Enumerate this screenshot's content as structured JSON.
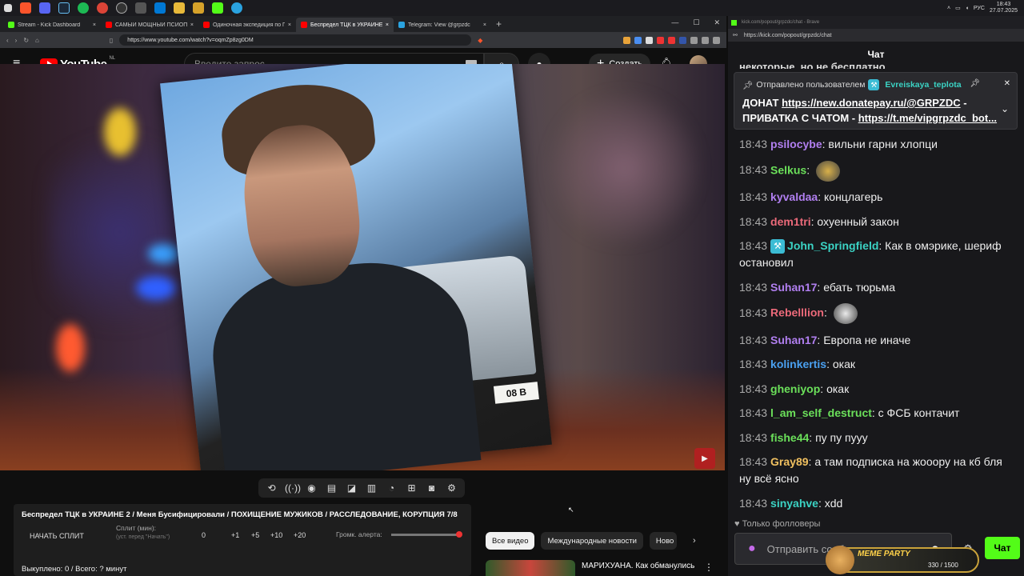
{
  "taskbar": {
    "lang": "РУС",
    "time": "18:43",
    "date": "27.07.2025"
  },
  "browser": {
    "tabs": [
      {
        "label": "Stream - Kick Dashboard",
        "color": "#53fc18",
        "active": false
      },
      {
        "label": "САМЫЙ МОЩНЫЙ ПСИОП НА РУ",
        "color": "#ff0000",
        "active": false
      },
      {
        "label": "Одиночная экспедиция по Приису",
        "color": "#ff0000",
        "active": false
      },
      {
        "label": "Беспредел ТЦК в УКРАИНЕ",
        "color": "#ff0000",
        "active": true
      },
      {
        "label": "Telegram: View @grpzdc",
        "color": "#2aa3e0",
        "active": false
      }
    ],
    "url": "https://www.youtube.com/watch?v=oqmZp8zg0DM"
  },
  "youtube": {
    "logo": "YouTube",
    "country": "NL",
    "search_placeholder": "Введите запрос",
    "create": "Создать"
  },
  "video": {
    "plate": "08 B"
  },
  "info": {
    "title": "Беспредел ТЦК в УКРАИНЕ 2 / Меня Бусифицировали / ПОХИЩЕНИЕ МУЖИКОВ / РАССЛЕДОВАНИЕ, КОРУПЦИЯ 7/8",
    "split_button": "НАЧАТЬ СПЛИТ",
    "split_label": "Сплит (мин):",
    "split_hint": "(уст. перед \"Начать\")",
    "split_value": "0",
    "increments": [
      "+1",
      "+5",
      "+10",
      "+20"
    ],
    "volume_label": "Громк. алерта:",
    "bought": "Выкуплено: 0 / Всего: ? минут"
  },
  "chips": [
    "Все видео",
    "Международные новости",
    "Ново"
  ],
  "related": {
    "title": "МАРИХУАНА. Как обманулись"
  },
  "chat_panel": {
    "tab_url": "kick.com/popout/grpzdc/chat - Brave",
    "url": "https://kick.com/popout/grpzdc/chat",
    "header": "Чат",
    "cut_text": "некоторые, но не бесплатно",
    "pinned": {
      "sent_by": "Отправлено пользователем",
      "user": "Evreiskaya_teplota",
      "line1_prefix": "ДОНАТ ",
      "line1_link": "https://new.donatepay.ru/@GRPZDC",
      "line1_suffix": " -",
      "line2_prefix": "ПРИВАТКА С ЧАТОМ - ",
      "line2_link": "https://t.me/vipgrpzdc_bot..."
    },
    "messages": [
      {
        "time": "18:43",
        "user": "psilocybe",
        "color": "#b17ff0",
        "text": "вильни гарни хлопци"
      },
      {
        "time": "18:43",
        "user": "Selkus",
        "color": "#6be05a",
        "text": "",
        "emote": true,
        "emote_color": "#d8b04a"
      },
      {
        "time": "18:43",
        "user": "kyvaldaa",
        "color": "#b17ff0",
        "text": "концлагерь"
      },
      {
        "time": "18:43",
        "user": "dem1tri",
        "color": "#ec6a7a",
        "text": "охуенный закон"
      },
      {
        "time": "18:43",
        "user": "John_Springfield",
        "color": "#3bd3c4",
        "text": "Как в омэрике, шериф остановил",
        "badge": true
      },
      {
        "time": "18:43",
        "user": "Suhan17",
        "color": "#b17ff0",
        "text": "ебать тюрьма"
      },
      {
        "time": "18:43",
        "user": "Rebelllion",
        "color": "#ec6a7a",
        "text": "",
        "emote": true,
        "emote_color": "#eaeaea"
      },
      {
        "time": "18:43",
        "user": "Suhan17",
        "color": "#b17ff0",
        "text": "Европа не иначе"
      },
      {
        "time": "18:43",
        "user": "kolinkertis",
        "color": "#4aa0f0",
        "text": "окак"
      },
      {
        "time": "18:43",
        "user": "gheniyop",
        "color": "#6be05a",
        "text": "окак"
      },
      {
        "time": "18:43",
        "user": "l_am_self_destruct",
        "color": "#6be05a",
        "text": "с ФСБ контачит"
      },
      {
        "time": "18:43",
        "user": "fishe44",
        "color": "#6be05a",
        "text": "пу пу пууу"
      },
      {
        "time": "18:43",
        "user": "Gray89",
        "color": "#f0c060",
        "text": "а там подписка на жооору на кб бля ну всё ясно"
      },
      {
        "time": "18:43",
        "user": "sinyahve",
        "color": "#3bd3c4",
        "text": "xdd"
      }
    ],
    "followers_only": "Только фолловеры",
    "input_placeholder": "Отправить сообщение",
    "send": "Чат"
  },
  "meme_party": {
    "title": "MEME PARTY",
    "progress": "330 / 1500"
  }
}
